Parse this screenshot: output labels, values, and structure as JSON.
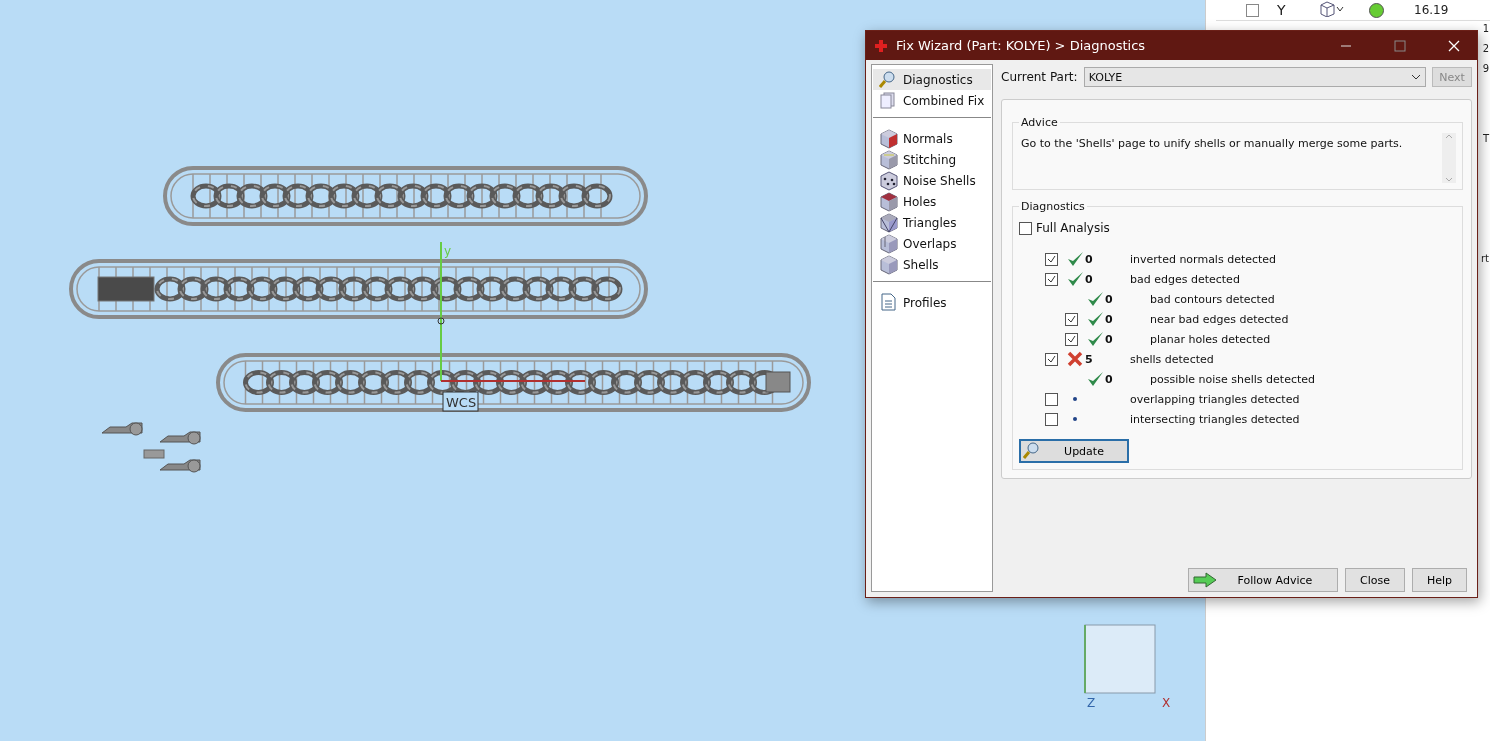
{
  "viewport": {
    "axis_label": "y",
    "wcs_label": "WCS",
    "viewcube": {
      "z_label": "Z",
      "x_label": "X"
    }
  },
  "side_panel": {
    "rows": [
      {
        "axis": "Y",
        "value": "16.19",
        "checked": false,
        "color": "#66cc33"
      }
    ],
    "edge_fragments": [
      "1",
      "2",
      "9",
      "T",
      "rt"
    ]
  },
  "dialog": {
    "title": "Fix Wizard (Part: KOLYE) > Diagnostics",
    "nav": [
      [
        {
          "label": "Diagnostics",
          "selected": true
        },
        {
          "label": "Combined Fix",
          "selected": false
        }
      ],
      [
        {
          "label": "Normals",
          "selected": false
        },
        {
          "label": "Stitching",
          "selected": false
        },
        {
          "label": "Noise Shells",
          "selected": false
        },
        {
          "label": "Holes",
          "selected": false
        },
        {
          "label": "Triangles",
          "selected": false
        },
        {
          "label": "Overlaps",
          "selected": false
        },
        {
          "label": "Shells",
          "selected": false
        }
      ],
      [
        {
          "label": "Profiles",
          "selected": false
        }
      ]
    ],
    "current_part": {
      "label": "Current Part:",
      "value": "KOLYE"
    },
    "next_button": {
      "label": "Next",
      "disabled": true
    },
    "advice": {
      "title": "Advice",
      "text": "Go to the 'Shells' page to unify shells or manually merge some parts."
    },
    "diagnostics": {
      "title": "Diagnostics",
      "full_analysis": {
        "label": "Full Analysis",
        "checked": false
      },
      "checks": [
        {
          "kind": "checkbox",
          "checked": true,
          "passed": true,
          "count": "0",
          "label": "inverted normals detected"
        },
        {
          "kind": "checkbox",
          "checked": true,
          "passed": true,
          "count": "0",
          "label": "bad edges detected",
          "children": [
            {
              "kind": "plain",
              "passed": true,
              "count": "0",
              "label": "bad contours detected"
            },
            {
              "kind": "checkbox",
              "checked": true,
              "passed": true,
              "count": "0",
              "label": "near bad edges detected"
            },
            {
              "kind": "checkbox",
              "checked": true,
              "passed": true,
              "count": "0",
              "label": "planar holes detected"
            }
          ]
        },
        {
          "kind": "checkbox",
          "checked": true,
          "passed": false,
          "count": "5",
          "label": "shells detected",
          "children": [
            {
              "kind": "plain",
              "passed": true,
              "count": "0",
              "label": "possible noise shells detected"
            }
          ]
        },
        {
          "kind": "checkbox",
          "checked": false,
          "label": "overlapping triangles detected"
        },
        {
          "kind": "checkbox",
          "checked": false,
          "label": "intersecting triangles detected"
        }
      ],
      "update_button": "Update"
    },
    "buttons": [
      {
        "kind": "arrow",
        "label": "Follow Advice"
      },
      {
        "kind": "plain",
        "label": "Close"
      },
      {
        "kind": "plain",
        "label": "Help"
      }
    ]
  }
}
